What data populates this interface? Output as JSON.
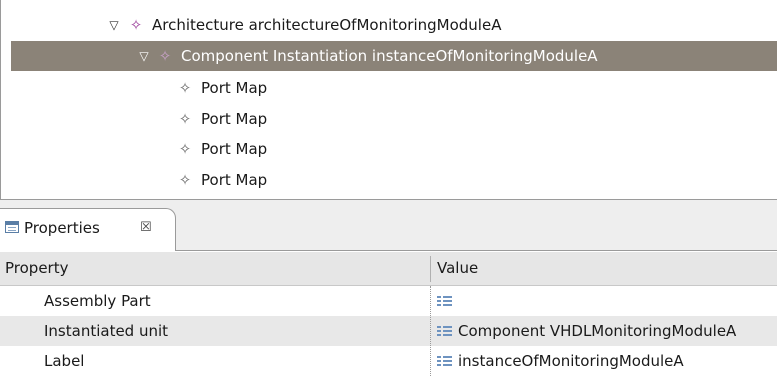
{
  "tree": {
    "rows": [
      {
        "label": "Architecture architectureOfMonitoringModuleA",
        "icon": "diamond-purple-icon",
        "expanded": true,
        "selected": false
      },
      {
        "label": "Component Instantiation instanceOfMonitoringModuleA",
        "icon": "diamond-light-icon",
        "expanded": true,
        "selected": true
      },
      {
        "label": "Port Map",
        "icon": "diamond-grey-icon"
      },
      {
        "label": "Port Map",
        "icon": "diamond-grey-icon"
      },
      {
        "label": "Port Map",
        "icon": "diamond-grey-icon"
      },
      {
        "label": "Port Map",
        "icon": "diamond-grey-icon"
      }
    ],
    "twisty_glyph": "▽",
    "node_glyph": "✧",
    "selection_color": "#8b8378"
  },
  "properties": {
    "tab_label": "Properties",
    "tab_close": "☒",
    "header": {
      "property": "Property",
      "value": "Value"
    },
    "rows": [
      {
        "property": "Assembly Part",
        "value": ""
      },
      {
        "property": "Instantiated unit",
        "value": "Component VHDLMonitoringModuleA"
      },
      {
        "property": "Label",
        "value": "instanceOfMonitoringModuleA"
      }
    ]
  }
}
